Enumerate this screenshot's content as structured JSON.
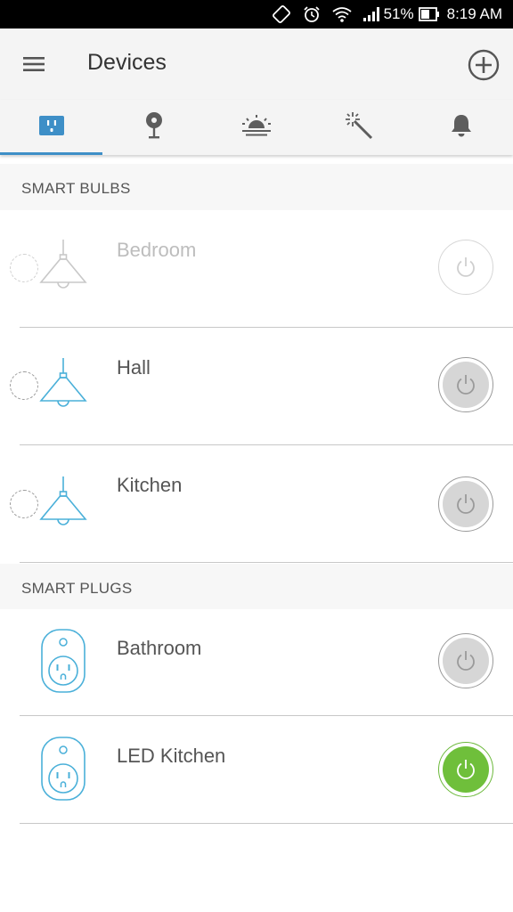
{
  "status_bar": {
    "battery_percent": "51%",
    "time": "8:19 AM",
    "icons": [
      "rotate-icon",
      "alarm-icon",
      "wifi-icon",
      "signal-icon",
      "battery-icon"
    ]
  },
  "app_bar": {
    "title": "Devices",
    "icons": [
      "menu-icon",
      "add-circle-icon"
    ]
  },
  "tabs": [
    {
      "icon": "smart-plug-icon",
      "active": true
    },
    {
      "icon": "camera-icon",
      "active": false
    },
    {
      "icon": "sunrise-icon",
      "active": false
    },
    {
      "icon": "magic-wand-icon",
      "active": false
    },
    {
      "icon": "bell-icon",
      "active": false
    }
  ],
  "sections": {
    "bulbs_header": "SMART BULBS",
    "plugs_header": "SMART PLUGS"
  },
  "bulbs": [
    {
      "name": "Bedroom",
      "state": "unreachable",
      "icon": "pendant-lamp-icon"
    },
    {
      "name": "Hall",
      "state": "off",
      "icon": "pendant-lamp-icon"
    },
    {
      "name": "Kitchen",
      "state": "off",
      "icon": "pendant-lamp-icon"
    }
  ],
  "plugs": [
    {
      "name": "Bathroom",
      "state": "off",
      "icon": "smart-plug-icon"
    },
    {
      "name": "LED Kitchen",
      "state": "on",
      "icon": "smart-plug-icon"
    }
  ],
  "colors": {
    "accent_blue": "#3e8fc7",
    "device_icon_blue": "#4ab0d9",
    "power_on_green": "#6fbf3b",
    "power_off_gray": "#d6d6d6"
  }
}
